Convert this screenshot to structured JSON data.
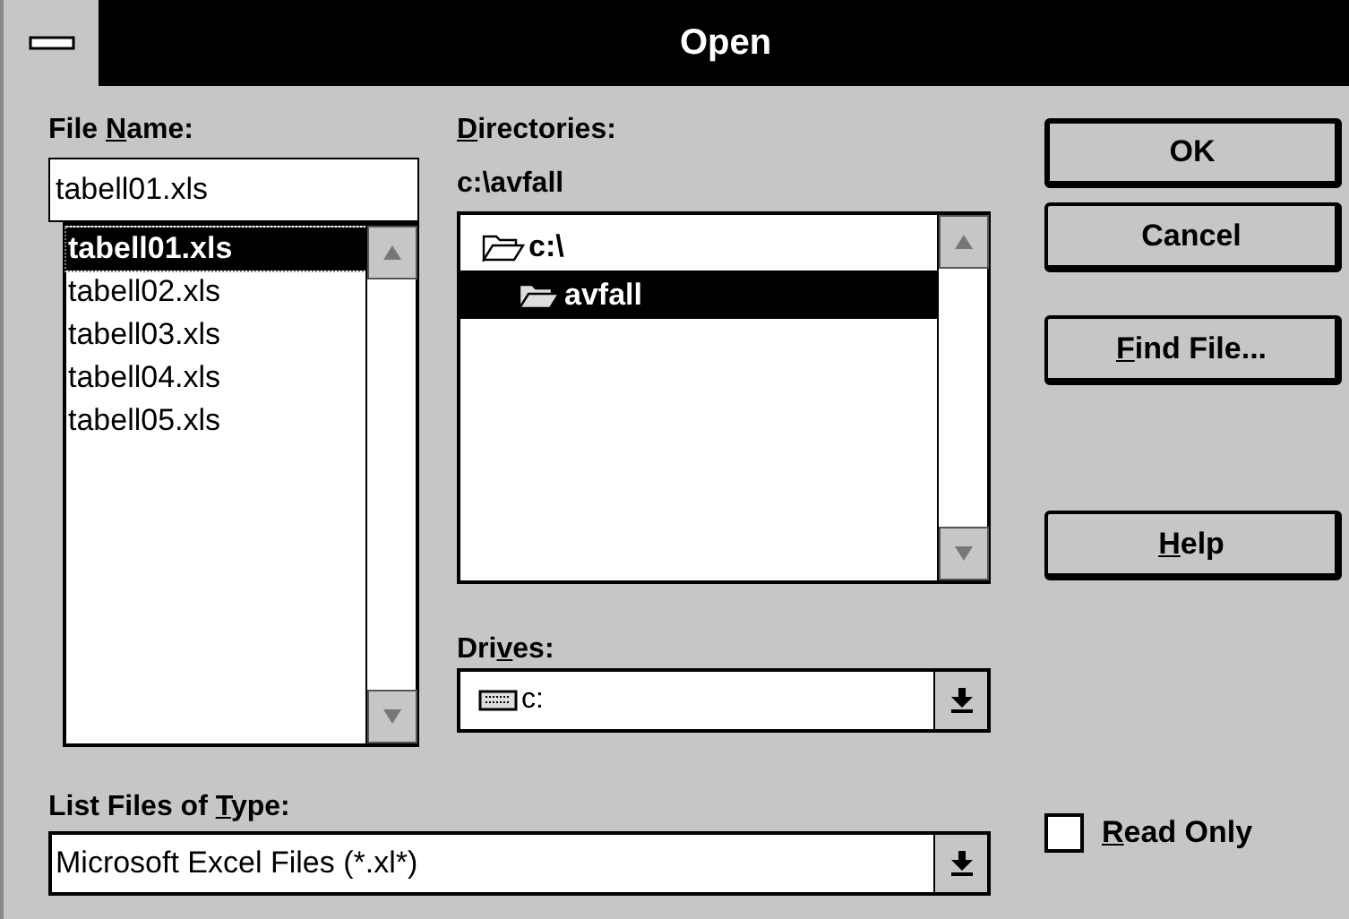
{
  "window": {
    "title": "Open"
  },
  "file_name": {
    "label": {
      "before": "File ",
      "key": "N",
      "after": "ame:"
    },
    "value": "tabell01.xls"
  },
  "files": [
    {
      "label": "tabell01.xls",
      "selected": true
    },
    {
      "label": "tabell02.xls",
      "selected": false
    },
    {
      "label": "tabell03.xls",
      "selected": false
    },
    {
      "label": "tabell04.xls",
      "selected": false
    },
    {
      "label": "tabell05.xls",
      "selected": false
    }
  ],
  "directories": {
    "label": {
      "key": "D",
      "after": "irectories:"
    },
    "path": "c:\\avfall",
    "items": [
      {
        "label": "c:\\",
        "selected": false,
        "children": [
          {
            "label": "avfall",
            "selected": true
          }
        ]
      }
    ]
  },
  "drives": {
    "label": {
      "before": "Dri",
      "key": "v",
      "after": "es:"
    },
    "value": "c:"
  },
  "file_type": {
    "label": {
      "before": "List Files of ",
      "key": "T",
      "after": "ype:"
    },
    "value": "Microsoft Excel Files (*.xl*)"
  },
  "buttons": [
    {
      "label": {
        "after": "OK"
      },
      "default": true
    },
    {
      "label": {
        "after": "Cancel"
      },
      "default": false
    },
    {
      "label": {
        "key": "F",
        "after": "ind File..."
      },
      "default": false
    },
    {
      "label": {
        "key": "H",
        "after": "elp"
      },
      "default": false
    }
  ],
  "read_only": {
    "label": {
      "key": "R",
      "after": "ead Only"
    },
    "checked": false
  }
}
